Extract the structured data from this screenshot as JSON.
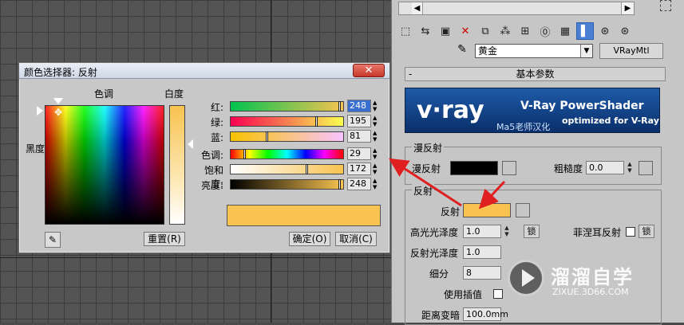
{
  "panel": {
    "scroll_left": "◀",
    "scroll_right": "▶",
    "material_name": "黄金",
    "material_type": "VRayMtl",
    "rollout_minus": "-",
    "rollout_title": "基本参数",
    "banner": {
      "logo_text": "v·ray",
      "brand": "V-Ray PowerShader",
      "sub": "optimized for V-Ray",
      "credit": "Ma5老师汉化"
    },
    "diffuse": {
      "group": "漫反射",
      "label": "漫反射",
      "roughness_label": "粗糙度",
      "roughness_value": "0.0",
      "color": "#000000"
    },
    "reflect": {
      "group": "反射",
      "label": "反射",
      "color": "#f8c350",
      "hilight_gloss_label": "高光光泽度",
      "hilight_gloss_value": "1.0",
      "lock_label": "锁",
      "fresnel_label": "菲涅耳反射",
      "lock2_label": "锁",
      "refl_gloss_label": "反射光泽度",
      "refl_gloss_value": "1.0",
      "subdivs_label": "细分",
      "subdivs_value": "8",
      "interp_label": "使用插值",
      "dim_label": "距离变暗",
      "dim_value": "100.0mm"
    }
  },
  "watermark": {
    "title": "溜溜自学",
    "url": "ZIXUE.3D66.COM"
  },
  "dialog": {
    "title": "颜色选择器: 反射",
    "close": "✕",
    "hue_label": "色调",
    "whiteness_label": "白度",
    "blackness_label": "黑度",
    "reset": "重置(R)",
    "ok": "确定(O)",
    "cancel": "取消(C)",
    "sliders": [
      {
        "label": "红:",
        "value": "248",
        "fraction": 0.973
      },
      {
        "label": "绿:",
        "value": "195",
        "fraction": 0.765
      },
      {
        "label": "蓝:",
        "value": "81",
        "fraction": 0.318
      },
      {
        "label": "色调:",
        "value": "29",
        "fraction": 0.114
      },
      {
        "label": "饱和度:",
        "value": "172",
        "fraction": 0.675
      },
      {
        "label": "亮度:",
        "value": "248",
        "fraction": 0.973
      }
    ],
    "preview_color": "#f8c350"
  },
  "colors": {
    "accent_blue": "#3a6fd0",
    "arrow_red": "#e02020",
    "close_red": "#c7382a"
  }
}
